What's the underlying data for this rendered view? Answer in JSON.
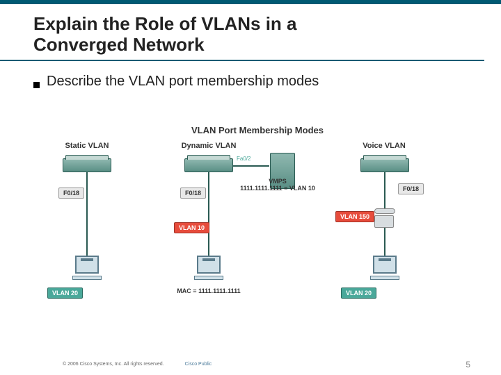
{
  "title_line1": "Explain the Role of VLANs in a",
  "title_line2": "Converged Network",
  "bullet": "Describe the VLAN port membership modes",
  "diagram": {
    "title": "VLAN Port Membership Modes",
    "col1_label": "Static VLAN",
    "col2_label": "Dynamic VLAN",
    "col3_label": "Voice VLAN",
    "port_f018_a": "F0/18",
    "port_f018_b": "F0/18",
    "port_f018_c": "F0/18",
    "port_fa02": "Fa0/2",
    "vmps_line1": "VMPS",
    "vmps_line2": "1111.1111.1111 = VLAN 10",
    "vlan10": "VLAN 10",
    "vlan20_a": "VLAN 20",
    "vlan20_b": "VLAN 20",
    "vlan150": "VLAN 150",
    "mac": "MAC = 1111.1111.1111"
  },
  "footer": {
    "copyright": "© 2006 Cisco Systems, Inc. All rights reserved.",
    "cisco_public": "Cisco Public",
    "page": "5"
  }
}
